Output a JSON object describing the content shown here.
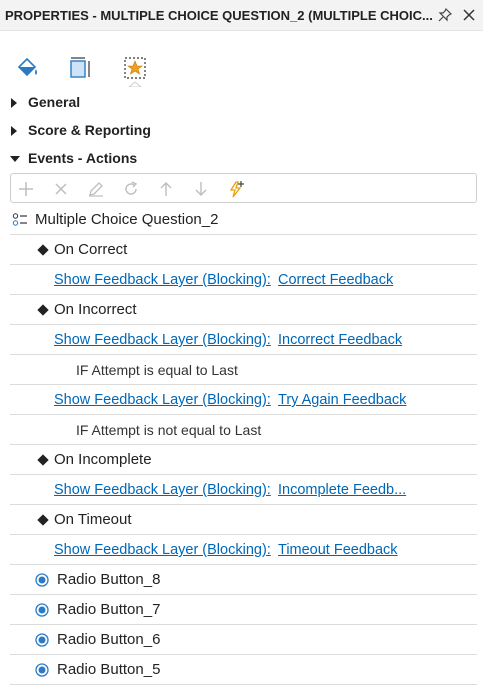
{
  "window": {
    "title": "PROPERTIES - MULTIPLE CHOICE QUESTION_2 (MULTIPLE CHOIC...",
    "pin_icon": "pin-icon",
    "close_icon": "close-icon"
  },
  "tabs": [
    {
      "icon": "paint-bucket-icon"
    },
    {
      "icon": "size-position-icon"
    },
    {
      "icon": "interaction-star-icon",
      "active": true
    }
  ],
  "sections": [
    {
      "label": "General",
      "expanded": false
    },
    {
      "label": "Score & Reporting",
      "expanded": false
    },
    {
      "label": "Events - Actions",
      "expanded": true
    }
  ],
  "toolbar": [
    "add-icon",
    "delete-icon",
    "edit-icon",
    "redo-icon",
    "move-up-icon",
    "move-down-icon",
    "new-trigger-icon"
  ],
  "tree": {
    "root": "Multiple Choice Question_2",
    "events": [
      {
        "label": "On Correct",
        "actions": [
          {
            "action": "Show Feedback Layer (Blocking):",
            "target": "Correct Feedback"
          }
        ]
      },
      {
        "label": "On Incorrect",
        "actions": [
          {
            "action": "Show Feedback Layer (Blocking):",
            "target": "Incorrect Feedback"
          },
          {
            "condition": "IF Attempt is equal to Last"
          },
          {
            "action": "Show Feedback Layer (Blocking):",
            "target": "Try Again Feedback"
          },
          {
            "condition": "IF Attempt is not equal to Last"
          }
        ]
      },
      {
        "label": "On Incomplete",
        "actions": [
          {
            "action": "Show Feedback Layer (Blocking):",
            "target": "Incomplete Feedb..."
          }
        ]
      },
      {
        "label": "On Timeout",
        "actions": [
          {
            "action": "Show Feedback Layer (Blocking):",
            "target": "Timeout Feedback"
          }
        ]
      }
    ],
    "radios": [
      "Radio Button_8",
      "Radio Button_7",
      "Radio Button_6",
      "Radio Button_5"
    ]
  },
  "colors": {
    "link": "#0067b8",
    "accent": "#2a7ac6",
    "star": "#f0a020",
    "trigger": "#e8a010"
  }
}
